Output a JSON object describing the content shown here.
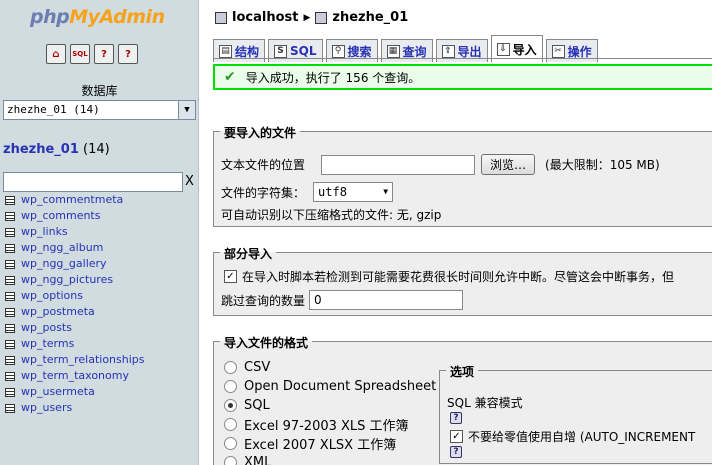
{
  "logo": {
    "php": "php",
    "my": "My",
    "admin": "Admin"
  },
  "nav_icons": [
    "home-icon",
    "sql-icon",
    "query-window-icon",
    "docs-icon"
  ],
  "db_label": "数据库",
  "db_select": "zhezhe_01 (14)",
  "db_title": {
    "name": "zhezhe_01",
    "count": "(14)"
  },
  "filter_clear": "X",
  "tables": [
    "wp_commentmeta",
    "wp_comments",
    "wp_links",
    "wp_ngg_album",
    "wp_ngg_gallery",
    "wp_ngg_pictures",
    "wp_options",
    "wp_postmeta",
    "wp_posts",
    "wp_terms",
    "wp_term_relationships",
    "wp_term_taxonomy",
    "wp_usermeta",
    "wp_users"
  ],
  "breadcrumb": {
    "server": "localhost",
    "db": "zhezhe_01"
  },
  "tabs": [
    "结构",
    "SQL",
    "搜索",
    "查询",
    "导出",
    "导入",
    "操作"
  ],
  "active_tab": "导入",
  "success_msg": "导入成功，执行了 156 个查询。",
  "import_file": {
    "legend": "要导入的文件",
    "location_label": "文本文件的位置",
    "browse": "浏览…",
    "limit": "(最大限制：105 MB)",
    "charset_label": "文件的字符集：",
    "charset_value": "utf8",
    "compression": "可自动识别以下压缩格式的文件: 无, gzip"
  },
  "partial": {
    "legend": "部分导入",
    "interrupt_label": "在导入时脚本若检测到可能需要花费很长时间则允许中断。尽管这会中断事务，但",
    "skip_label": "跳过查询的数量",
    "skip_value": "0"
  },
  "format": {
    "legend": "导入文件的格式",
    "options": [
      "CSV",
      "Open Document Spreadsheet",
      "SQL",
      "Excel 97-2003 XLS 工作簿",
      "Excel 2007 XLSX 工作簿",
      "XML"
    ],
    "selected": "SQL"
  },
  "options": {
    "legend": "选项",
    "compat_label": "SQL 兼容模式",
    "auto_inc_label": "不要给零值使用自增 (AUTO_INCREMENT"
  },
  "colors": {
    "success_border": "#00dd00",
    "link": "#2832b4",
    "left_bg": "#d0dce0"
  }
}
